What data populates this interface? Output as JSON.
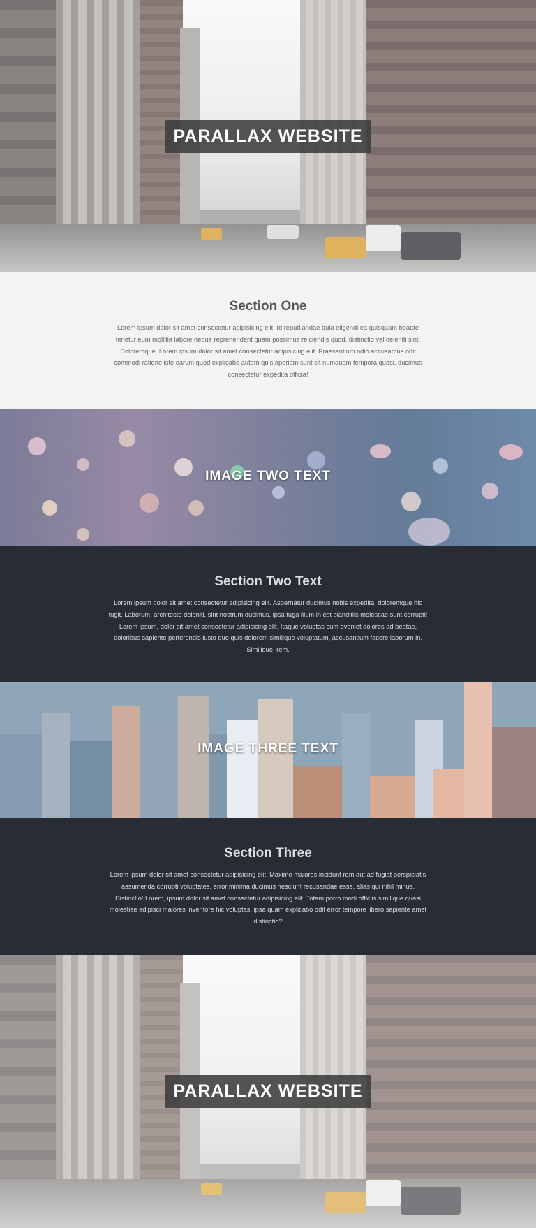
{
  "hero_top": {
    "title": "PARALLAX WEBSITE"
  },
  "section_one": {
    "heading": "Section One",
    "body": "Lorem ipsum dolor sit amet consectetur adipisicing elit. Id repudiandae quia eligendi ea quisquam beatae tenetur eum mollitia labore neque reprehenderit quam possimus reiciendis quod, distinctio vel deleniti sint. Doloremque. Lorem ipsum dolor sit amet consectetur adipisicing elit. Praesentium odio accusamus odit commodi ratione iste earum quod explicabo autem quis aperiam sunt sit numquam tempora quasi, ducimus consectetur expedita officia!"
  },
  "image_two": {
    "label": "IMAGE TWO TEXT"
  },
  "section_two": {
    "heading": "Section Two Text",
    "body": "Lorem ipsum dolor sit amet consectetur adipisicing elit. Aspernatur ducimus nobis expedita, doloremque hic fugit. Laborum, architecto deleniti, sint nostrum ducimus, ipsa fuga illum in est blanditiis molestiae sunt corrupti! Lorem ipsum, dolor sit amet consectetur adipisicing elit. Itaque voluptas cum eveniet dolores ad beatae, doloribus sapiente perferendis iusto quo quis dolorem similique voluptatum, accusantium facere laborum in. Similique, rem."
  },
  "image_three": {
    "label": "IMAGE THREE TEXT"
  },
  "section_three": {
    "heading": "Section Three",
    "body": "Lorem ipsum dolor sit amet consectetur adipisicing elit. Maxime maiores incidunt rem aut ad fugiat perspiciatis assumenda corrupti voluptates, error minima ducimus nesciunt recusandae esse, alias qui nihil minus. Distinctio! Lorem, ipsum dolor sit amet consectetur adipisicing elit. Totam porro modi officiis similique quasi molestiae adipisci maiores inventore hic voluptas, ipsa quam explicabo odit error tempore libero sapiente amet distinctio?"
  },
  "hero_bottom": {
    "title": "PARALLAX WEBSITE"
  },
  "colors": {
    "dark_section_bg": "#282c35",
    "light_section_bg": "#f3f3f3",
    "title_box_bg": "#3c3c3c"
  },
  "images": {
    "hero": "city-street-photo",
    "image_two": "bokeh-city-lights-photo",
    "image_three": "city-skyline-aerial-photo"
  }
}
